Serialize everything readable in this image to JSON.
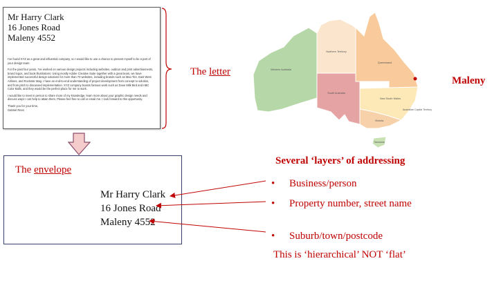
{
  "letter": {
    "address_lines": [
      "Mr Harry Clark",
      "16 Jones Road",
      "Maleny 4552"
    ],
    "paragraphs": [
      "I've found XYZ as a great and influential company, so I would like to use a chance to present myself to be a part of your design team.",
      "For the past four years, I've worked on various design projects including websites, outdoor and print advertisements, brand logos, and book illustrations. Using mostly Adobe Creative Suite together with a great team, we have implemented successful design solutions for more than 70 websites, including brands such as Mao Tire, East West Airlines, and Rockstar Mag. I have an end-to-end understanding of project development from concept to solution, and from pitch to discussed implementation. XYZ company boasts famous work such as Dove Milk Bird and ABC Color Balls, and they would be the perfect place for me to work.",
      "I would like to meet in person to share more of my knowledge, learn more about your graphic design needs and discuss ways I can help to attain them. Please feel free to call or email me. I look forward to this opportunity.",
      "Thank you for your time,\nGabriel Rees"
    ]
  },
  "letter_label": {
    "prefix": "The ",
    "word": "letter"
  },
  "map": {
    "region_labels": {
      "wa": "Western Australia",
      "nt": "Northern Territory",
      "qld": "Queensland",
      "sa": "South Australia",
      "nsw": "New South Wales",
      "act": "Australian Capital Territory",
      "vic": "Victoria",
      "tas": "Tasmania"
    },
    "marker_label": "Maleny",
    "colors": {
      "wa": "#b6d7a8",
      "nt": "#fce5cd",
      "qld": "#f9cb9c",
      "sa": "#e6a3a3",
      "nsw": "#fde9b8",
      "vic": "#f6d1a9",
      "tas": "#c9e2b3"
    }
  },
  "envelope": {
    "label_prefix": "The ",
    "label_word": "envelope",
    "address_lines": [
      "Mr Harry Clark",
      "16 Jones Road",
      "Maleny 4552"
    ]
  },
  "layers": {
    "title": "Several ‘layers’ of addressing",
    "bullet_char": "•",
    "bullets": [
      "Business/person",
      "Property number, street name",
      "Suburb/town/postcode"
    ],
    "footer": "This is ‘hierarchical’ NOT ‘flat’"
  },
  "accent_color": "#c00000"
}
